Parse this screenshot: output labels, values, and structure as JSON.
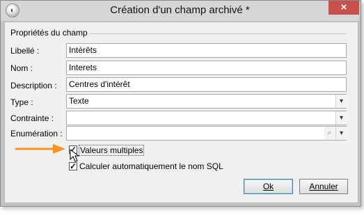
{
  "window": {
    "title": "Création d'un champ archivé *",
    "close_glyph": "×"
  },
  "group": {
    "title": "Propriétés du champ"
  },
  "fields": {
    "libelle": {
      "label": "Libellé :",
      "value": "Intérêts"
    },
    "nom": {
      "label": "Nom :",
      "value": "Interets"
    },
    "description": {
      "label": "Description :",
      "value": "Centres d'intérêt"
    },
    "type": {
      "label": "Type :",
      "value": "Texte"
    },
    "contrainte": {
      "label": "Contrainte :",
      "value": ""
    },
    "enumeration": {
      "label": "Enumération :",
      "value": ""
    }
  },
  "options": {
    "multiple": {
      "label": "Valeurs multiples",
      "checked": true
    },
    "auto_sql": {
      "label": "Calculer automatiquement le nom SQL",
      "checked": true
    }
  },
  "buttons": {
    "ok": "Ok",
    "cancel": "Annuler"
  },
  "colors": {
    "arrow": "#f7941d",
    "close": "#c7504c"
  }
}
